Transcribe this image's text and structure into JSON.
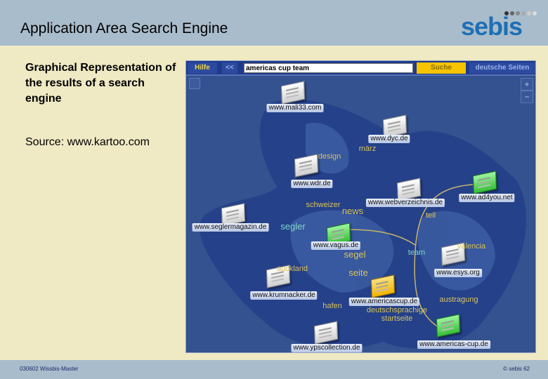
{
  "header": {
    "title": "Application Area Search Engine",
    "logo_text": "sebis"
  },
  "left": {
    "description": "Graphical Representation of the results of a search engine",
    "source": "Source: www.kartoo.com"
  },
  "kartoo": {
    "toolbar": {
      "help": "Hilfe",
      "back": "<<",
      "query": "americas cup team",
      "search": "Suche",
      "german_pages": "deutsche Seiten"
    },
    "zoom_in": "+",
    "zoom_out": "−",
    "sites": [
      "www.mali33.com",
      "www.dyc.de",
      "www.wdr.de",
      "www.webverzeichnis.de",
      "www.ad4you.net",
      "www.seglermagazin.de",
      "www.vagus.de",
      "www.esys.org",
      "www.krumnacker.de",
      "www.americascup.de",
      "www.ypscollection.de",
      "www.americas-cup.de"
    ],
    "keywords": [
      "design",
      "märz",
      "schweizer",
      "news",
      "segler",
      "teil",
      "team",
      "segel",
      "valencia",
      "auckland",
      "seite",
      "austragung",
      "hafen",
      "deutschsprachige startseite"
    ]
  },
  "footer": {
    "left": "030602 Wissbis-Master",
    "right": "© sebis 62"
  },
  "colors": {
    "header": "#a9bccb",
    "background": "#efe9c4",
    "map": "#34528f",
    "keyword": "#d9c25a",
    "keyword_highlight": "#7fd6c6",
    "logo": "#1f6fb5"
  }
}
